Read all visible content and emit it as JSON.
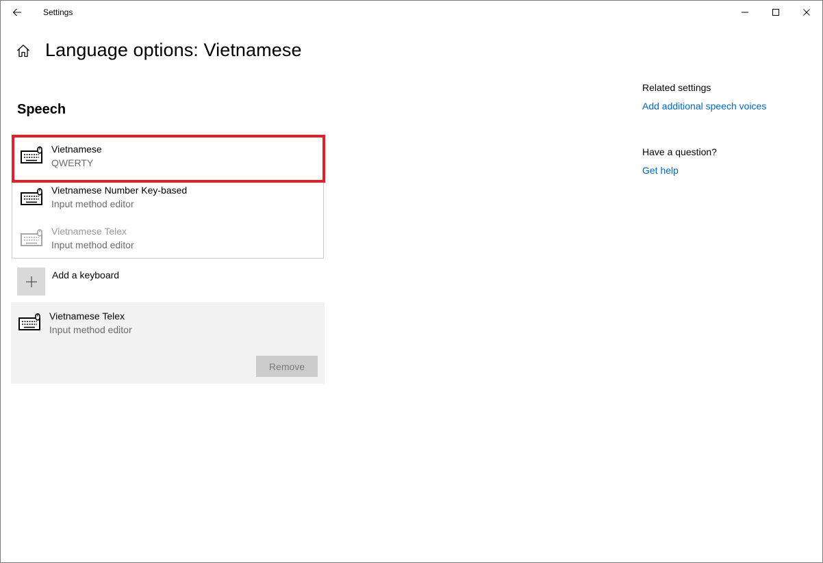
{
  "titlebar": {
    "app_title": "Settings"
  },
  "header": {
    "title": "Language options: Vietnamese"
  },
  "section": {
    "title": "Speech"
  },
  "keyboards": [
    {
      "name": "Vietnamese",
      "subtitle": "QWERTY",
      "icon": "keyboard-icon"
    },
    {
      "name": "Vietnamese Number Key-based",
      "subtitle": "Input method editor",
      "icon": "keyboard-icon"
    },
    {
      "name": "Vietnamese Telex",
      "subtitle": "Input method editor",
      "icon": "keyboard-icon"
    }
  ],
  "add_keyboard": {
    "label": "Add a keyboard",
    "icon": "plus-icon"
  },
  "selected_keyboard": {
    "name": "Vietnamese Telex",
    "subtitle": "Input method editor",
    "remove_label": "Remove"
  },
  "related": {
    "heading": "Related settings",
    "link": "Add additional speech voices"
  },
  "question": {
    "heading": "Have a question?",
    "link": "Get help"
  },
  "colors": {
    "accent": "#0067c0",
    "highlight": "#e0202a",
    "panel": "#f2f2f2"
  }
}
